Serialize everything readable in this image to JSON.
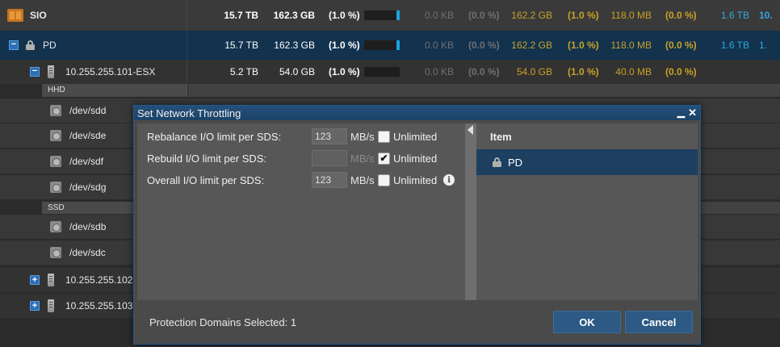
{
  "rows": {
    "sio": {
      "name": "SIO",
      "cap": "15.7 TB",
      "used": "162.3 GB",
      "pct": "(1.0 %)",
      "v1": "0.0 KB",
      "p1": "(0.0 %)",
      "v2": "162.2 GB",
      "p2": "(1.0 %)",
      "v3": "118.0 MB",
      "p3": "(0.0 %)",
      "v4": "1.6 TB",
      "v5": "10."
    },
    "pd": {
      "name": "PD",
      "cap": "15.7 TB",
      "used": "162.3 GB",
      "pct": "(1.0 %)",
      "v1": "0.0 KB",
      "p1": "(0.0 %)",
      "v2": "162.2 GB",
      "p2": "(1.0 %)",
      "v3": "118.0 MB",
      "p3": "(0.0 %)",
      "v4": "1.6 TB",
      "v5": "1."
    },
    "esx101": {
      "name": "10.255.255.101-ESX",
      "cap": "5.2 TB",
      "used": "54.0 GB",
      "pct": "(1.0 %)",
      "v1": "0.0 KB",
      "p1": "(0.0 %)",
      "v2": "54.0 GB",
      "p2": "(1.0 %)",
      "v3": "40.0 MB",
      "p3": "(0.0 %)"
    },
    "hdd_label": "HHD",
    "hdd_devices": [
      "/dev/sdd",
      "/dev/sde",
      "/dev/sdf",
      "/dev/sdg"
    ],
    "ssd_label": "SSD",
    "ssd_devices": [
      "/dev/sdb",
      "/dev/sdc"
    ],
    "esx102": {
      "name": "10.255.255.102"
    },
    "esx103": {
      "name": "10.255.255.103"
    }
  },
  "dialog": {
    "title": "Set Network Throttling",
    "fields": {
      "rebalance": {
        "label": "Rebalance I/O limit per SDS:",
        "value": "123",
        "unit": "MB/s",
        "unlimited": "Unlimited"
      },
      "rebuild": {
        "label": "Rebuild I/O limit per SDS:",
        "value": "",
        "unit": "MB/s",
        "unlimited": "Unlimited"
      },
      "overall": {
        "label": "Overall I/O limit per SDS:",
        "value": "123",
        "unit": "MB/s",
        "unlimited": "Unlimited"
      }
    },
    "item_header": "Item",
    "item": "PD",
    "status": "Protection Domains Selected: 1",
    "ok": "OK",
    "cancel": "Cancel"
  },
  "colors": {
    "selected_row": "#12324e",
    "accent_blue": "#1aa3e0",
    "gold": "#c9a227"
  }
}
